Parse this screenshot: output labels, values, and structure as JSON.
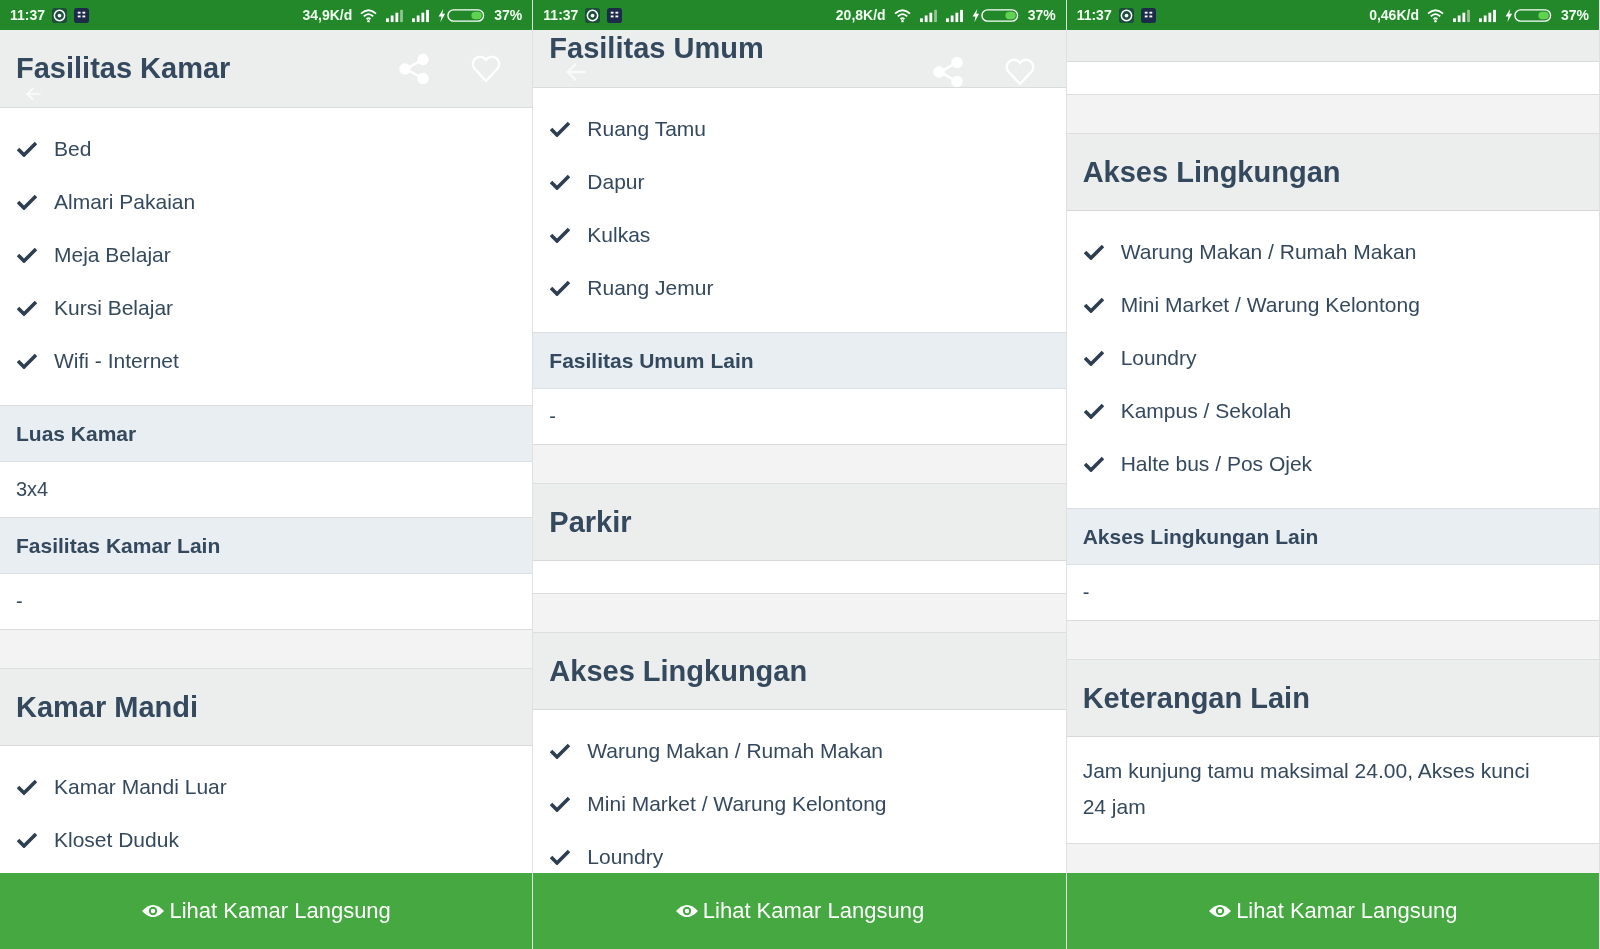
{
  "screens": [
    {
      "status_bar": {
        "time": "11:37",
        "speed": "34,9K/d",
        "battery": "37%"
      },
      "toolbar": {
        "kind": "inline",
        "title": "Fasilitas Kamar"
      },
      "sections": [
        {
          "kind": "list",
          "items": [
            {
              "label": "Bed",
              "checked": true
            },
            {
              "label": "Almari Pakaian",
              "checked": true
            },
            {
              "label": "Meja Belajar",
              "checked": true
            },
            {
              "label": "Kursi Belajar",
              "checked": true
            },
            {
              "label": "Wifi - Internet",
              "checked": true
            }
          ]
        },
        {
          "kind": "subheader",
          "text": "Luas Kamar"
        },
        {
          "kind": "value",
          "text": "3x4"
        },
        {
          "kind": "subheader",
          "text": "Fasilitas Kamar Lain"
        },
        {
          "kind": "value",
          "text": "-"
        },
        {
          "kind": "gap"
        },
        {
          "kind": "heading",
          "text": "Kamar Mandi"
        },
        {
          "kind": "list",
          "items": [
            {
              "label": "Kamar Mandi Luar",
              "checked": true
            },
            {
              "label": "Kloset Duduk",
              "checked": true
            }
          ]
        }
      ],
      "action": {
        "label": "Lihat Kamar Langsung"
      }
    },
    {
      "status_bar": {
        "time": "11:37",
        "speed": "20,8K/d",
        "battery": "37%"
      },
      "toolbar": {
        "kind": "stacked",
        "title": "Fasilitas Umum"
      },
      "sections": [
        {
          "kind": "list",
          "items": [
            {
              "label": "Ruang Tamu",
              "checked": true
            },
            {
              "label": "Dapur",
              "checked": true
            },
            {
              "label": "Kulkas",
              "checked": true
            },
            {
              "label": "Ruang Jemur",
              "checked": true
            }
          ]
        },
        {
          "kind": "subheader",
          "text": "Fasilitas Umum Lain"
        },
        {
          "kind": "value",
          "text": "-"
        },
        {
          "kind": "gap"
        },
        {
          "kind": "heading",
          "text": "Parkir"
        },
        {
          "kind": "empty"
        },
        {
          "kind": "gap"
        },
        {
          "kind": "heading",
          "text": "Akses Lingkungan"
        },
        {
          "kind": "list",
          "items": [
            {
              "label": "Warung Makan / Rumah Makan",
              "checked": true
            },
            {
              "label": "Mini Market / Warung Kelontong",
              "checked": true
            },
            {
              "label": "Loundry",
              "checked": true
            }
          ]
        }
      ],
      "action": {
        "label": "Lihat Kamar Langsung"
      }
    },
    {
      "status_bar": {
        "time": "11:37",
        "speed": "0,46K/d",
        "battery": "37%"
      },
      "toolbar": {
        "kind": "stub"
      },
      "sections": [
        {
          "kind": "gap"
        },
        {
          "kind": "heading",
          "text": "Akses Lingkungan"
        },
        {
          "kind": "list",
          "items": [
            {
              "label": "Warung Makan / Rumah Makan",
              "checked": true
            },
            {
              "label": "Mini Market / Warung Kelontong",
              "checked": true
            },
            {
              "label": "Loundry",
              "checked": true
            },
            {
              "label": "Kampus / Sekolah",
              "checked": true
            },
            {
              "label": "Halte bus / Pos Ojek",
              "checked": true
            }
          ]
        },
        {
          "kind": "subheader",
          "text": "Akses Lingkungan Lain"
        },
        {
          "kind": "value",
          "text": "-"
        },
        {
          "kind": "gap"
        },
        {
          "kind": "heading",
          "text": "Keterangan Lain"
        },
        {
          "kind": "paragraph",
          "text": "Jam kunjung tamu maksimal 24.00, Akses kunci 24 jam"
        }
      ],
      "action": {
        "label": "Lihat Kamar Langsung"
      }
    }
  ]
}
